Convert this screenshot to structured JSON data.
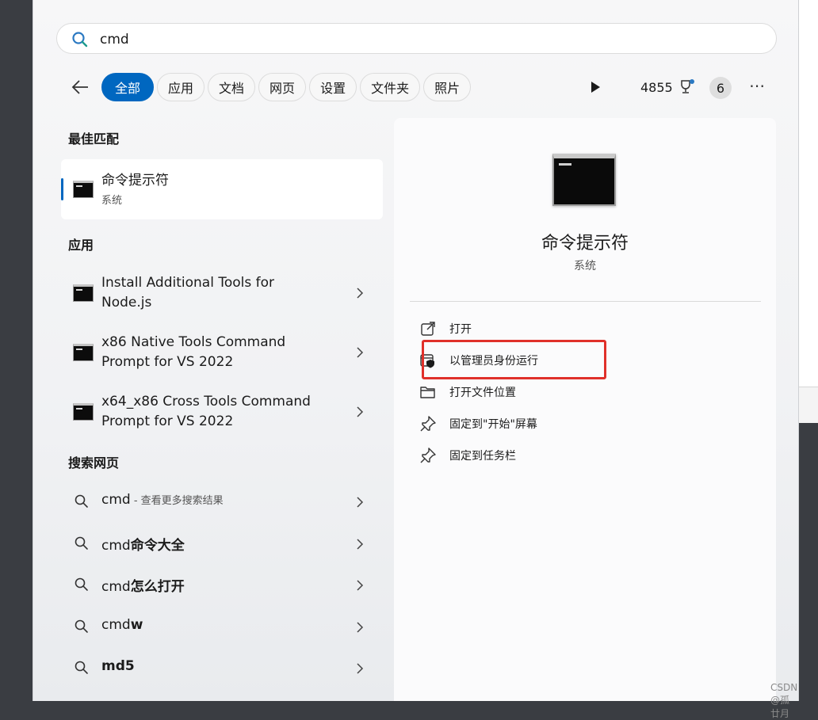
{
  "search": {
    "value": "cmd",
    "placeholder": ""
  },
  "filters": {
    "tabs": [
      {
        "label": "全部"
      },
      {
        "label": "应用"
      },
      {
        "label": "文档"
      },
      {
        "label": "网页"
      },
      {
        "label": "设置"
      },
      {
        "label": "文件夹"
      },
      {
        "label": "照片"
      }
    ],
    "points": "4855",
    "badge": "6"
  },
  "best_match": {
    "heading": "最佳匹配",
    "title": "命令提示符",
    "subtitle": "系统"
  },
  "apps": {
    "heading": "应用",
    "items": [
      {
        "line1": "Install Additional Tools for",
        "line2": "Node.js"
      },
      {
        "line1": "x86 Native Tools Command",
        "line2": "Prompt for VS 2022"
      },
      {
        "line1": "x64_x86 Cross Tools Command",
        "line2": "Prompt for VS 2022"
      }
    ]
  },
  "web": {
    "heading": "搜索网页",
    "items": [
      {
        "prefix": "cmd",
        "bold": "",
        "hint": " - 查看更多搜索结果"
      },
      {
        "prefix": "cmd",
        "bold": "命令大全",
        "hint": ""
      },
      {
        "prefix": "cmd",
        "bold": "怎么打开",
        "hint": ""
      },
      {
        "prefix": "cmd",
        "bold": "w",
        "hint": ""
      },
      {
        "prefix": "",
        "bold": "md5",
        "hint": ""
      }
    ]
  },
  "detail": {
    "title": "命令提示符",
    "subtitle": "系统",
    "actions": [
      {
        "label": "打开",
        "icon": "open-external-icon"
      },
      {
        "label": "以管理员身份运行",
        "icon": "admin-shield-icon"
      },
      {
        "label": "打开文件位置",
        "icon": "folder-icon"
      },
      {
        "label": "固定到\"开始\"屏幕",
        "icon": "pin-icon"
      },
      {
        "label": "固定到任务栏",
        "icon": "pin-icon"
      }
    ]
  },
  "watermark": "CSDN @孤廿月",
  "colors": {
    "accent": "#0067c0",
    "highlight": "#e0302a"
  }
}
